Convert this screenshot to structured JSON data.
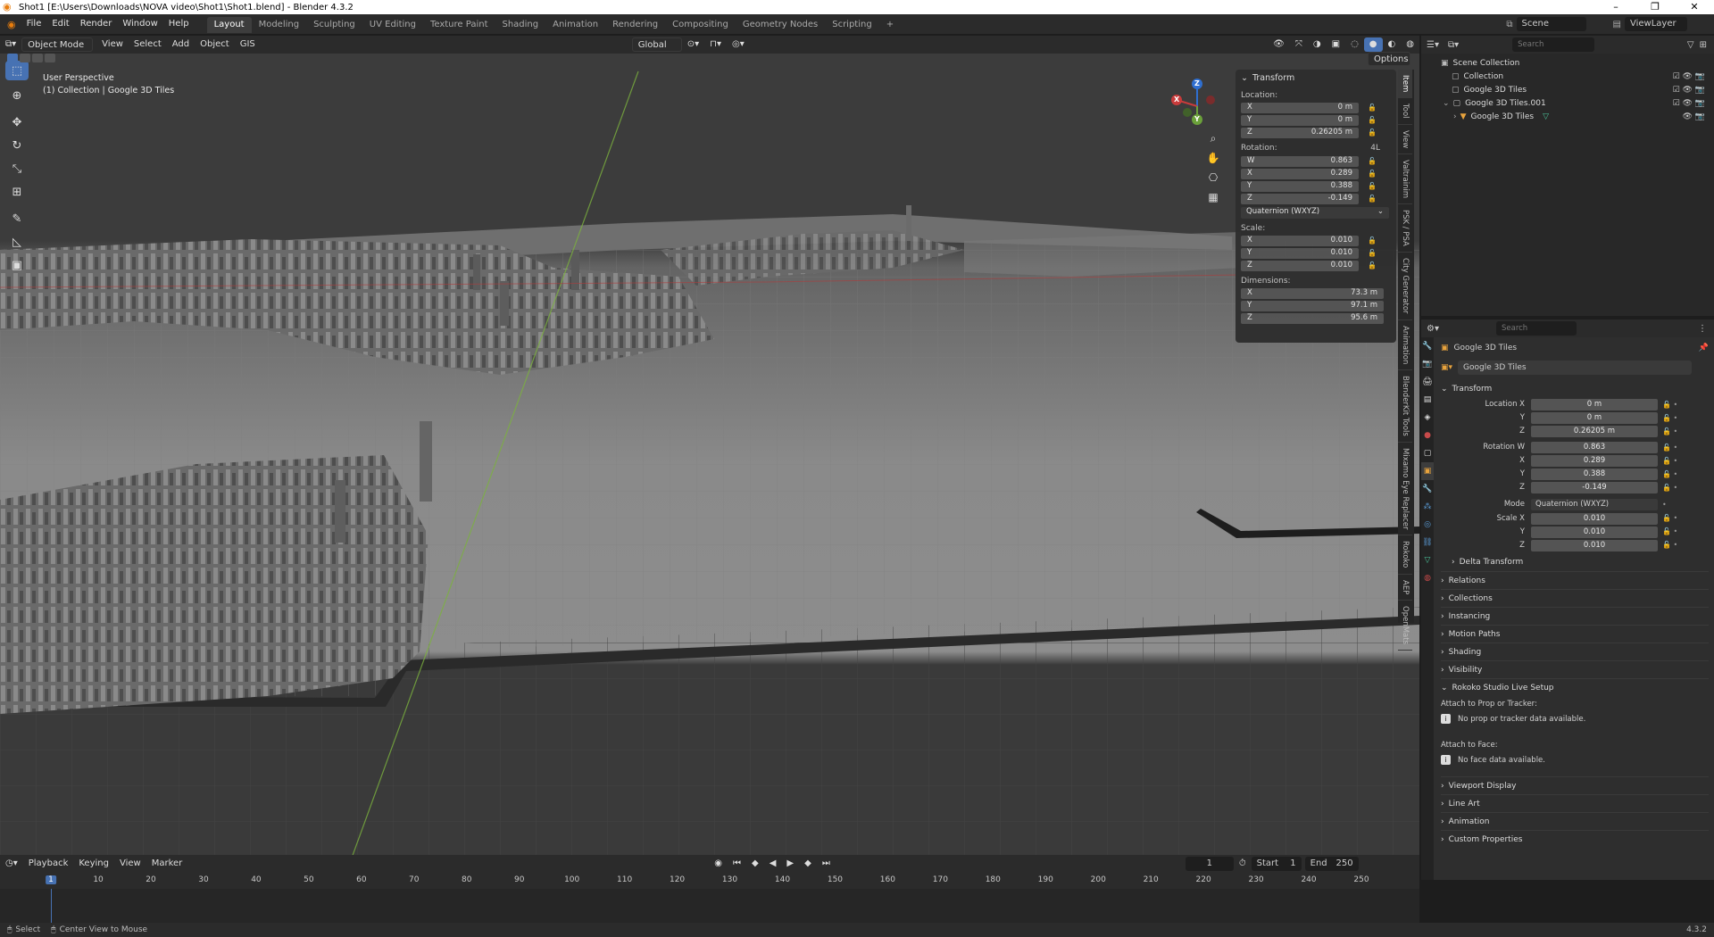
{
  "window": {
    "title": "Shot1 [E:\\Users\\Downloads\\NOVA video\\Shot1\\Shot1.blend] - Blender 4.3.2",
    "controls": [
      "–",
      "❐",
      "✕"
    ]
  },
  "menu": [
    "File",
    "Edit",
    "Render",
    "Window",
    "Help"
  ],
  "workspaces": [
    "Layout",
    "Modeling",
    "Sculpting",
    "UV Editing",
    "Texture Paint",
    "Shading",
    "Animation",
    "Rendering",
    "Compositing",
    "Geometry Nodes",
    "Scripting"
  ],
  "active_workspace": "Layout",
  "add_workspace": "+",
  "scene": {
    "label": "Scene",
    "viewlayer": "ViewLayer"
  },
  "viewport": {
    "mode": "Object Mode",
    "menus": [
      "View",
      "Select",
      "Add",
      "Object",
      "GIS"
    ],
    "orientation": "Global",
    "options_label": "Options",
    "overlay_line1": "User Perspective",
    "overlay_line2": "(1) Collection | Google 3D Tiles",
    "gizmo": {
      "x": "X",
      "y": "Y",
      "z": "Z"
    }
  },
  "npanel": {
    "header": "Transform",
    "location_label": "Location:",
    "location": [
      {
        "axis": "X",
        "value": "0 m"
      },
      {
        "axis": "Y",
        "value": "0 m"
      },
      {
        "axis": "Z",
        "value": "0.26205 m"
      }
    ],
    "rotation_label": "Rotation:",
    "rotation_mode_label": "4L",
    "rotation": [
      {
        "axis": "W",
        "value": "0.863"
      },
      {
        "axis": "X",
        "value": "0.289"
      },
      {
        "axis": "Y",
        "value": "0.388"
      },
      {
        "axis": "Z",
        "value": "-0.149"
      }
    ],
    "rotation_mode": "Quaternion (WXYZ)",
    "scale_label": "Scale:",
    "scale": [
      {
        "axis": "X",
        "value": "0.010"
      },
      {
        "axis": "Y",
        "value": "0.010"
      },
      {
        "axis": "Z",
        "value": "0.010"
      }
    ],
    "dimensions_label": "Dimensions:",
    "dimensions": [
      {
        "axis": "X",
        "value": "73.3 m"
      },
      {
        "axis": "Y",
        "value": "97.1 m"
      },
      {
        "axis": "Z",
        "value": "95.6 m"
      }
    ]
  },
  "side_tabs": [
    "Item",
    "Tool",
    "View",
    "Valtrainim",
    "PSK / PSA",
    "City Generator",
    "Animation",
    "BlenderKit Tools",
    "Mixamo Eye Replacer",
    "Rokoko",
    "AEP",
    "OpenMats"
  ],
  "outliner": {
    "search_placeholder": "Search",
    "rows": [
      {
        "label": "Scene Collection",
        "indent": 0
      },
      {
        "label": "Collection",
        "indent": 1
      },
      {
        "label": "Google 3D Tiles",
        "indent": 1
      },
      {
        "label": "Google 3D Tiles.001",
        "indent": 1
      },
      {
        "label": "Google 3D Tiles",
        "indent": 2
      }
    ]
  },
  "properties": {
    "search_placeholder": "Search",
    "object_name": "Google 3D Tiles",
    "data_name": "Google 3D Tiles",
    "transform_header": "Transform",
    "location_label": "Location X",
    "location": [
      "0 m",
      "0 m",
      "0.26205 m"
    ],
    "rotation_label": "Rotation W",
    "rotation": [
      "0.863",
      "0.289",
      "0.388",
      "-0.149"
    ],
    "mode_label": "Mode",
    "mode_value": "Quaternion (WXYZ)",
    "scale_label": "Scale X",
    "scale": [
      "0.010",
      "0.010",
      "0.010"
    ],
    "axis_labels": [
      "X",
      "Y",
      "Z",
      "W"
    ],
    "delta": "Delta Transform",
    "sections_a": [
      "Relations",
      "Collections",
      "Instancing",
      "Motion Paths",
      "Shading",
      "Visibility"
    ],
    "rokoko_header": "Rokoko Studio Live Setup",
    "attach_prop_label": "Attach to Prop or Tracker:",
    "attach_prop_msg": "No prop or tracker data available.",
    "attach_face_label": "Attach to Face:",
    "attach_face_msg": "No face data available.",
    "sections_b": [
      "Viewport Display",
      "Line Art",
      "Animation",
      "Custom Properties"
    ]
  },
  "timeline": {
    "menus": [
      "Playback",
      "Keying",
      "View",
      "Marker"
    ],
    "current_frame": "1",
    "start_label": "Start",
    "start": "1",
    "end_label": "End",
    "end": "250",
    "ruler": [
      "1",
      "10",
      "20",
      "30",
      "40",
      "50",
      "60",
      "70",
      "80",
      "90",
      "100",
      "110",
      "120",
      "130",
      "140",
      "150",
      "160",
      "170",
      "180",
      "190",
      "200",
      "210",
      "220",
      "230",
      "240",
      "250"
    ]
  },
  "status": {
    "select": "Select",
    "center": "Center View to Mouse",
    "version": "4.3.2"
  }
}
